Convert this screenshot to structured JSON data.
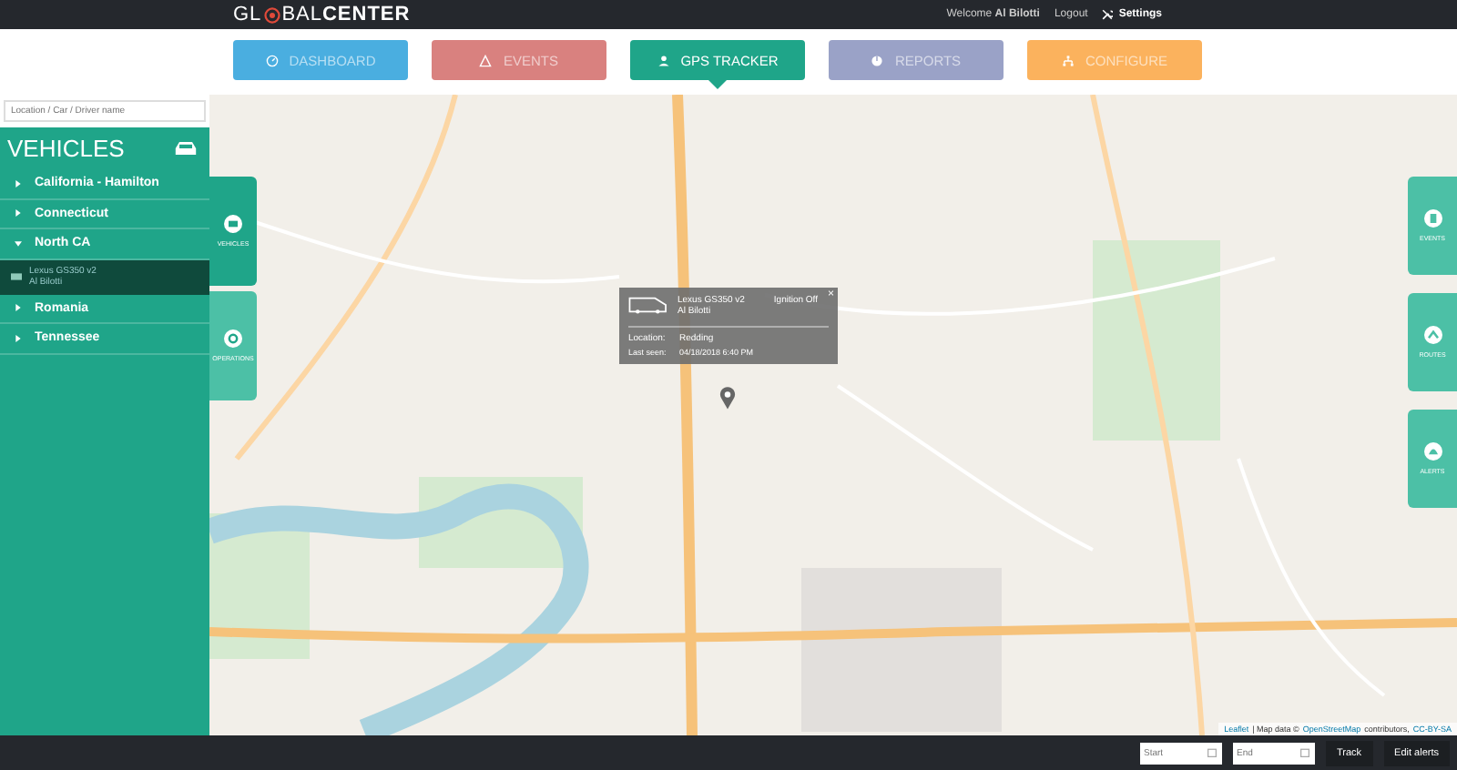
{
  "topbar": {
    "logo_left": "GL",
    "logo_mid": "BAL",
    "logo_bold": "CENTER",
    "welcome": "Welcome",
    "user": "Al Bilotti",
    "logout": "Logout",
    "settings": "Settings"
  },
  "nav": [
    {
      "label": "DASHBOARD",
      "kind": "dashboard",
      "color": "#4aaee0",
      "selected": false
    },
    {
      "label": "EVENTS",
      "kind": "events",
      "color": "#d9817f",
      "selected": false
    },
    {
      "label": "GPS TRACKER",
      "kind": "gps",
      "color": "#1fa589",
      "selected": true
    },
    {
      "label": "REPORTS",
      "kind": "reports",
      "color": "#9aa2c7",
      "selected": false
    },
    {
      "label": "CONFIGURE",
      "kind": "configure",
      "color": "#fbb25d",
      "selected": false
    }
  ],
  "sidebar": {
    "search": {
      "placeholder": "Location / Car / Driver name"
    },
    "title": "VEHICLES",
    "groups": [
      {
        "label": "California - Hamilton",
        "expanded": false
      },
      {
        "label": "Connecticut",
        "expanded": false
      },
      {
        "label": "North CA",
        "expanded": true,
        "children": [
          {
            "name": "Lexus GS350 v2",
            "driver": "Al Bilotti",
            "selected": true
          }
        ]
      },
      {
        "label": "Romania",
        "expanded": false
      },
      {
        "label": "Tennessee",
        "expanded": false
      }
    ]
  },
  "left_tabs": [
    {
      "label": "VEHICLES",
      "kind": "vehicles",
      "selected": true
    },
    {
      "label": "OPERATIONS",
      "kind": "operations",
      "selected": false
    }
  ],
  "right_tabs": [
    {
      "label": "EVENTS",
      "kind": "events"
    },
    {
      "label": "ROUTES",
      "kind": "routes"
    },
    {
      "label": "ALERTS",
      "kind": "alerts"
    }
  ],
  "popup": {
    "vehicle": "Lexus GS350 v2",
    "driver": "Al Bilotti",
    "ignition": "Ignition Off",
    "location_label": "Location:",
    "location": "Redding",
    "last_seen_label": "Last seen:",
    "last_seen": "04/18/2018 6:40 PM",
    "close": "×"
  },
  "attribution": {
    "leaflet": "Leaflet",
    "text": "| Map data ©",
    "osm": "OpenStreetMap",
    "contrib": "contributors,",
    "license": "CC-BY-SA"
  },
  "bottombar": {
    "start": {
      "placeholder": "Start"
    },
    "end": {
      "placeholder": "End"
    },
    "track": "Track",
    "edit_alerts": "Edit alerts"
  }
}
